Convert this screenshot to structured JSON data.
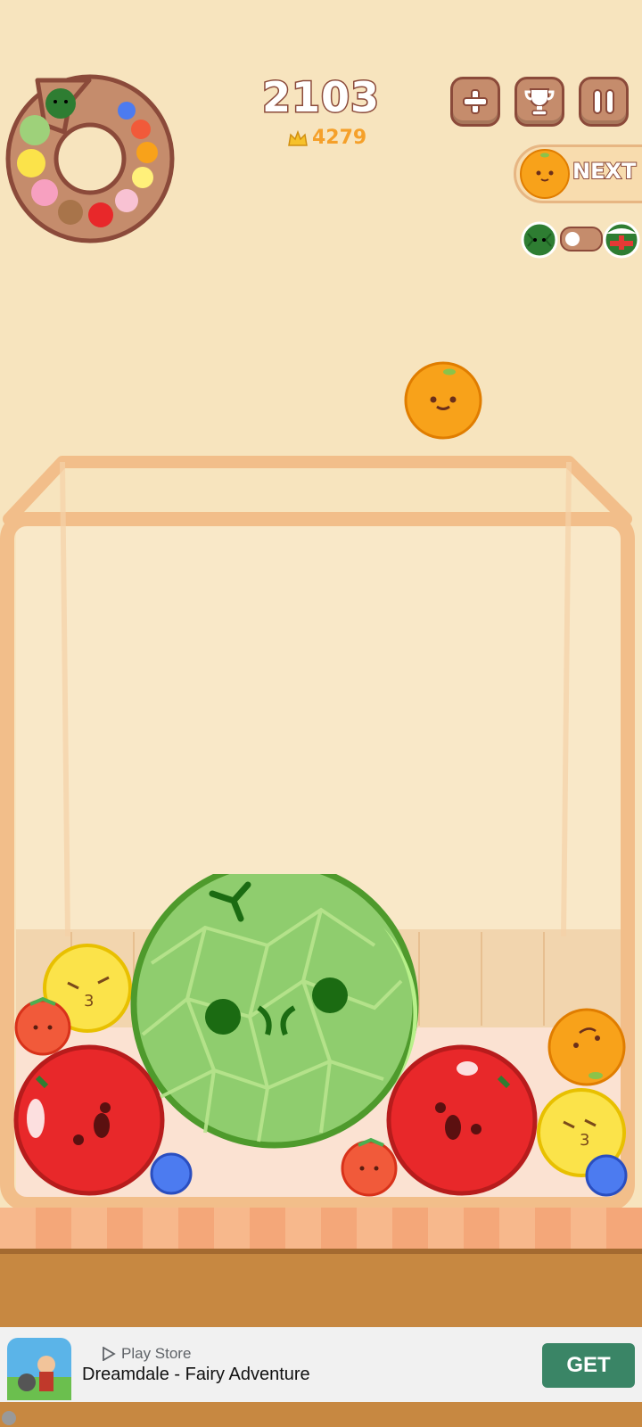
{
  "score": {
    "current": "2103",
    "best": "4279"
  },
  "icons": {
    "wheel": "fruit-evolution-wheel",
    "add": "plus-icon",
    "leaderboard": "trophy-icon",
    "pause": "pause-icon",
    "crown": "crown-icon",
    "next_fruit": "orange",
    "toggle_left": "watermelon-skin",
    "toggle_right": "christmas-watermelon-skin"
  },
  "next": {
    "label": "NEXT"
  },
  "current_drop_fruit": "orange",
  "jar_fruits": [
    "melon",
    "apple",
    "apple",
    "lemon",
    "lemon",
    "orange",
    "strawberry",
    "strawberry",
    "blueberry",
    "blueberry"
  ],
  "ad": {
    "source": "Play Store",
    "title": "Dreamdale - Fairy Adventure",
    "cta": "GET"
  },
  "colors": {
    "background": "#f7e4be",
    "wood": "#c58c6c",
    "outline": "#8b4a3a",
    "jar": "#f2be8a",
    "floor": "#c78841",
    "cta": "#3a8566"
  }
}
